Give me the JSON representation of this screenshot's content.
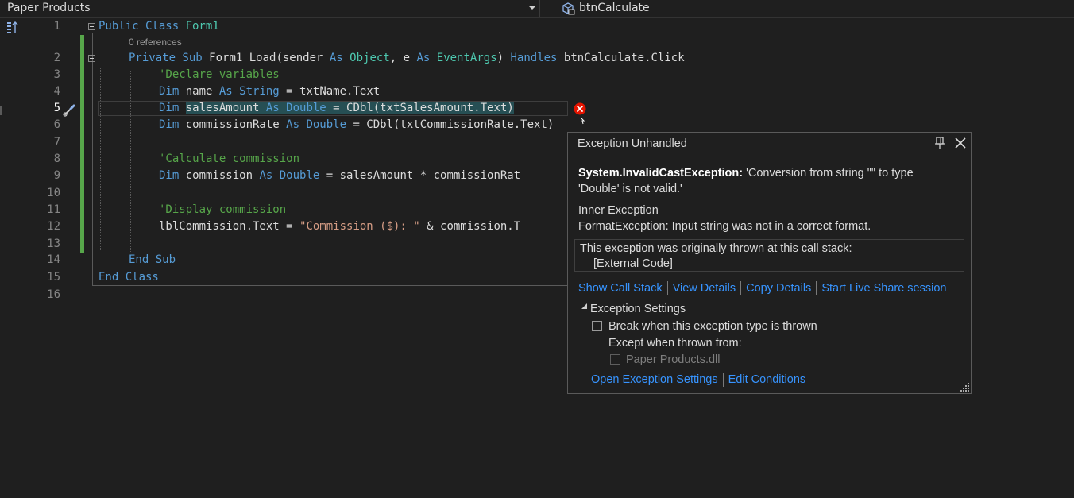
{
  "navbar": {
    "project": "Paper Products",
    "member": "btnCalculate",
    "member_icon": "control-icon",
    "chevron_icon": "chevron-down-icon"
  },
  "editor": {
    "active_line": 5,
    "codelens": "0 references",
    "line_numbers": [
      "1",
      "2",
      "3",
      "4",
      "5",
      "6",
      "7",
      "8",
      "9",
      "10",
      "11",
      "12",
      "13",
      "14",
      "15",
      "16"
    ],
    "lines": [
      {
        "tokens": [
          [
            "kw",
            "Public Class "
          ],
          [
            "ty",
            "Form1"
          ]
        ]
      },
      {
        "tokens": [
          [
            "kw",
            "Private Sub "
          ],
          [
            "",
            "Form1_Load(sender "
          ],
          [
            "kw",
            "As "
          ],
          [
            "ty",
            "Object"
          ],
          [
            "",
            ", e "
          ],
          [
            "kw",
            "As "
          ],
          [
            "ty",
            "EventArgs"
          ],
          [
            "",
            ") "
          ],
          [
            "kw",
            "Handles "
          ],
          [
            "",
            "btnCalculate.Click"
          ]
        ]
      },
      {
        "tokens": [
          [
            "cm",
            "'Declare variables"
          ]
        ]
      },
      {
        "tokens": [
          [
            "kw",
            "Dim "
          ],
          [
            "",
            "name "
          ],
          [
            "kw",
            "As String "
          ],
          [
            "",
            "= txtName.Text"
          ]
        ]
      },
      {
        "tokens": [
          [
            "kw",
            "Dim "
          ],
          [
            "hl",
            "salesAmount "
          ],
          [
            "hl kw",
            "As Double "
          ],
          [
            "hl",
            "= CDbl(txtSalesAmount.Text)"
          ]
        ]
      },
      {
        "tokens": [
          [
            "kw",
            "Dim "
          ],
          [
            "",
            "commissionRate "
          ],
          [
            "kw",
            "As Double "
          ],
          [
            "",
            "= CDbl(txtCommissionRate.Te"
          ],
          [
            "",
            "xt)"
          ]
        ]
      },
      {
        "tokens": []
      },
      {
        "tokens": [
          [
            "cm",
            "'Calculate commission"
          ]
        ]
      },
      {
        "tokens": [
          [
            "kw",
            "Dim "
          ],
          [
            "",
            "commission "
          ],
          [
            "kw",
            "As Double "
          ],
          [
            "",
            "= salesAmount * commissionRat"
          ]
        ]
      },
      {
        "tokens": []
      },
      {
        "tokens": [
          [
            "cm",
            "'Display commission"
          ]
        ]
      },
      {
        "tokens": [
          [
            "",
            "lblCommission.Text = "
          ],
          [
            "st",
            "\"Commission ($): \""
          ],
          [
            "",
            " & commission.T"
          ]
        ]
      },
      {
        "tokens": []
      },
      {
        "tokens": [
          [
            "kw",
            "End Sub"
          ]
        ]
      },
      {
        "tokens": [
          [
            "kw",
            "End Class"
          ]
        ]
      }
    ]
  },
  "popup": {
    "title": "Exception Unhandled",
    "exception_type": "System.InvalidCastException:",
    "exception_message": " 'Conversion from string \"\" to type 'Double' is not valid.'",
    "inner_title": "Inner Exception",
    "inner_message": "FormatException: Input string was not in a correct format.",
    "stack_title": "This exception was originally thrown at this call stack:",
    "stack_frame": "[External Code]",
    "links": {
      "show_call_stack": "Show Call Stack",
      "view_details": "View Details",
      "copy_details": "Copy Details",
      "live_share": "Start Live Share session"
    },
    "settings_title": "Exception Settings",
    "break_label": "Break when this exception type is thrown",
    "except_label": "Except when thrown from:",
    "module_label": "Paper Products.dll",
    "open_settings": "Open Exception Settings",
    "edit_conditions": "Edit Conditions"
  },
  "colors": {
    "keyword": "#569cd6",
    "type": "#4ec9b0",
    "comment": "#57a64a",
    "string": "#d69d85",
    "link": "#3794ff",
    "error": "#e51400"
  }
}
